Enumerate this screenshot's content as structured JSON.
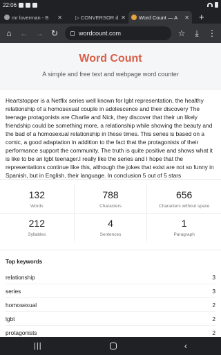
{
  "status": {
    "time": "22:06"
  },
  "tabs": [
    {
      "title": "mr loverman - B",
      "fav_color": "#9aa0a6"
    },
    {
      "title": "▷ CONVERSOR d",
      "fav_color": "#202124"
    },
    {
      "title": "Word Count — A",
      "fav_color": "#e6a23c"
    }
  ],
  "browser": {
    "url": "wordcount.com"
  },
  "site": {
    "brand": "Word Count",
    "tagline": "A simple and free text and webpage word counter"
  },
  "text": "Heartstopper is a Netflix series well known for lgbt representation, the healthy relationship of a homosexual couple in adolescence and their discovery The teenage protagonists are Charlie and Nick, they discover that their un likely friendship could be something more, a relationship while showing the beauty and the bad of a homosexual relationship in these times. This series is based on a comic, a good adaptation in addition to the fact that the protagonists of their performance support the community. The truth is quite positive and shows what it is like to be an lgbt teenager.I really like the series and I hope that the representations continue like this, although the jokes that exist are not so funny in Spanish, but in English, their language. In conclusion 5 out of 5 stars",
  "stats": [
    {
      "value": "132",
      "label": "Words"
    },
    {
      "value": "788",
      "label": "Characters"
    },
    {
      "value": "656",
      "label": "Characters without space"
    },
    {
      "value": "212",
      "label": "Syllables"
    },
    {
      "value": "4",
      "label": "Sentences"
    },
    {
      "value": "1",
      "label": "Paragraph"
    }
  ],
  "keywords": {
    "title": "Top keywords",
    "items": [
      {
        "word": "relationship",
        "count": "3"
      },
      {
        "word": "series",
        "count": "3"
      },
      {
        "word": "homosexual",
        "count": "2"
      },
      {
        "word": "lgbt",
        "count": "2"
      },
      {
        "word": "protagonists",
        "count": "2"
      }
    ]
  }
}
